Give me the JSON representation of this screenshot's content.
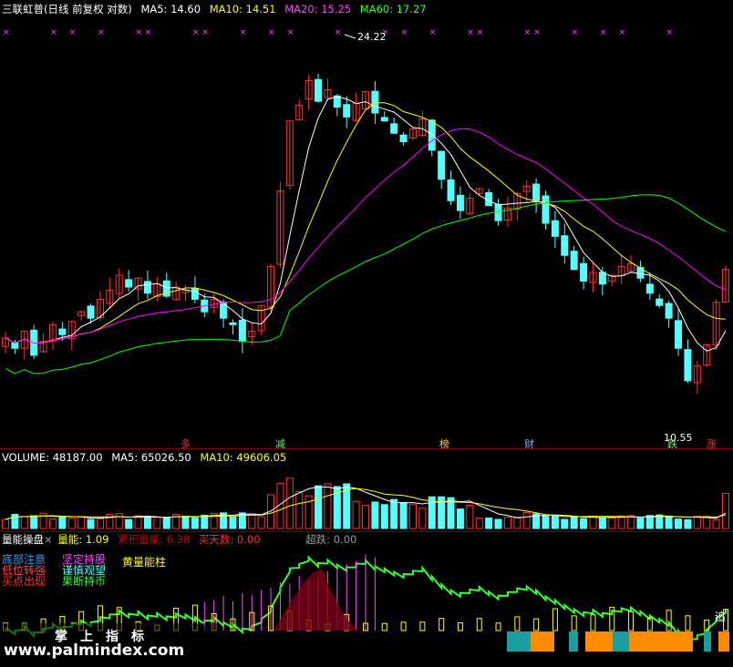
{
  "colors": {
    "ma5": "#ffffff",
    "ma10": "#ffff00",
    "ma20": "#ff00ff",
    "ma60": "#00ff00",
    "up": "#ff3030",
    "down": "#54ffff",
    "orange": "#ff8c00",
    "green_step": "#33ff33"
  },
  "main_panel": {
    "title": "三联虹普(日线 前复权 对数)",
    "ma5": {
      "label": "MA5:",
      "value": "14.60"
    },
    "ma10": {
      "label": "MA10:",
      "value": "14.51"
    },
    "ma20": {
      "label": "MA20:",
      "value": "15.25"
    },
    "ma60": {
      "label": "MA60:",
      "value": "17.27"
    },
    "high_label": "24.22",
    "low_label": "10.55",
    "event_markers": [
      {
        "text": "多",
        "color": "#ff3030"
      },
      {
        "text": "减",
        "color": "#55ff55"
      },
      {
        "text": "榜",
        "color": "#ffcc44"
      },
      {
        "text": "财",
        "color": "#88aaff"
      },
      {
        "text": "跌",
        "color": "#55ff55"
      },
      {
        "text": "涨",
        "color": "#ff3030"
      }
    ]
  },
  "volume_panel": {
    "volume": {
      "label": "VOLUME:",
      "value": "48187.00"
    },
    "ma5": {
      "label": "MA5:",
      "value": "65026.50"
    },
    "ma10": {
      "label": "MA10:",
      "value": "49606.05"
    }
  },
  "indicator_panel": {
    "name": "量能操盘",
    "close_glyph": "×",
    "lianeng": {
      "label": "量能:",
      "value": "1.09"
    },
    "jilei": {
      "label": "累积量能:",
      "value": "6.38"
    },
    "maitian": {
      "label": "买天数:",
      "value": "0.00"
    },
    "chaodie": {
      "label": "超跌:",
      "value": "0.00"
    },
    "legend_left": [
      "底部注意",
      "低位转强",
      "买点出现"
    ],
    "legend_mid": [
      "坚定持股",
      "谨慎观望",
      "果断持币"
    ],
    "legend_right": "黄量能柱",
    "zhui_label": "追"
  },
  "watermark": {
    "text": "掌上指标",
    "url": "www.palmindex.com"
  },
  "chart_data": {
    "type": "candlestick",
    "title": "三联虹普(日线 前复权 对数)",
    "scale": "log",
    "ma_values": {
      "MA5": 14.6,
      "MA10": 14.51,
      "MA20": 15.25,
      "MA60": 17.27
    },
    "annotated_high": 24.22,
    "annotated_low": 10.55,
    "volume": 48187.0,
    "volume_ma5": 65026.5,
    "volume_ma10": 49606.05,
    "indicator": {
      "量能": 1.09,
      "累积量能": 6.38,
      "买天数": 0.0,
      "超跌": 0.0
    },
    "closes": [
      12.4,
      12.1,
      12.6,
      11.9,
      12.3,
      12.8,
      12.5,
      12.9,
      13.2,
      13.0,
      13.6,
      13.9,
      14.4,
      14.0,
      14.3,
      13.8,
      14.1,
      13.7,
      14.0,
      13.9,
      13.6,
      13.2,
      13.6,
      13.0,
      12.8,
      12.3,
      12.6,
      13.4,
      14.7,
      17.6,
      20.8,
      21.6,
      22.9,
      21.8,
      22.4,
      21.5,
      21.0,
      21.7,
      22.3,
      21.2,
      20.8,
      20.2,
      19.8,
      20.4,
      20.9,
      19.4,
      18.1,
      17.2,
      16.8,
      17.3,
      17.7,
      17.0,
      16.4,
      16.9,
      17.5,
      17.8,
      17.2,
      16.3,
      15.8,
      15.1,
      14.6,
      14.2,
      14.5,
      14.1,
      14.4,
      14.7,
      14.8,
      14.3,
      13.8,
      13.4,
      13.0,
      12.1,
      11.2,
      11.6,
      12.2,
      13.5,
      14.6
    ]
  }
}
